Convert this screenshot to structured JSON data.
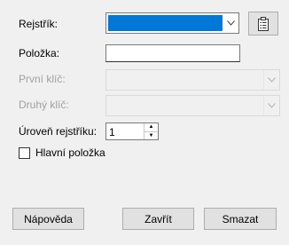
{
  "form": {
    "rejstrik_label": "Rejstřík:",
    "polozka_label": "Položka:",
    "polozka_value": "",
    "prvni_klic_label": "První klíč:",
    "druhy_klic_label": "Druhý klíč:",
    "uroven_label": "Úroveň rejstříku:",
    "uroven_value": "1",
    "hlavni_polozka_label": "Hlavní položka",
    "hlavni_polozka_checked": false
  },
  "buttons": {
    "help": "Nápověda",
    "close": "Zavřít",
    "delete": "Smazat"
  },
  "icons": {
    "new_index": "new-index-document-icon",
    "dropdown": "chevron-down-icon"
  },
  "colors": {
    "selection": "#0078d7",
    "disabled_text": "#a0a0a0"
  }
}
